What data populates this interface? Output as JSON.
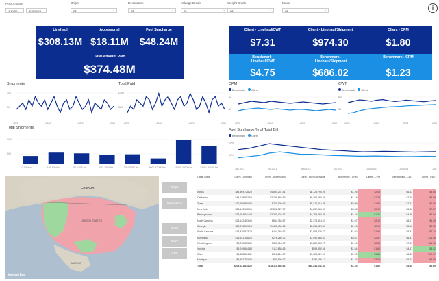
{
  "filters": {
    "period_label": "PERIOD DATE",
    "date_from": "1/1/2021",
    "date_to": "5/31/2024",
    "origin_label": "Origin",
    "destination_label": "Destination",
    "mileage_label": "Mileage Break",
    "weight_label": "Weight Break",
    "mode_label": "Mode",
    "all": "All"
  },
  "kpis": {
    "linehaul_label": "Linehaul",
    "linehaul": "$308.13M",
    "accessorial_label": "Accessorial",
    "accessorial": "$18.11M",
    "fuel_label": "Fuel Surcharge",
    "fuel": "$48.24M",
    "total_label": "Total Amount Paid",
    "total": "$374.48M"
  },
  "client": {
    "cwt_label": "Client - Linehaul/CWT",
    "cwt": "$7.31",
    "shipment_label": "Client - Linehaul/Shipment",
    "shipment": "$974.30",
    "cpm_label": "Client - CPM",
    "cpm": "$1.80"
  },
  "benchmark": {
    "cwt_label": "Benchmark - Linehaul/CWT",
    "cwt": "$4.75",
    "shipment_label": "Benchmark - Linehaul/Shipment",
    "shipment": "$686.02",
    "cpm_label": "Benchmark - CPM",
    "cpm": "$1.23"
  },
  "charts": {
    "shipments_title": "Shipments",
    "total_paid_title": "Total Paid",
    "cpm_title": "CPM",
    "cwt_title": "CWT",
    "total_shipments_title": "Total Shipments",
    "fuel_title": "Fuel Surcharge % of Total Bill",
    "legend_benchmark": "Benchmark",
    "legend_client": "Client",
    "year_ticks": [
      "2021",
      "2022",
      "2023",
      "2024"
    ],
    "date_ticks": [
      "Jan 2021",
      "Jul 2021",
      "Jan 2022",
      "Jul 2022",
      "Jan 2023",
      "Jul 2023",
      "Jan 2024"
    ],
    "shipments_y": [
      "10K",
      "5K"
    ],
    "paid_y": [
      "$10M",
      "$5M"
    ],
    "cpm_y": [
      "$2",
      "$1"
    ],
    "cwt_y": [
      "$10",
      "$5"
    ],
    "tot_ship_y": [
      "100K",
      "50K"
    ],
    "fuel_y": [
      "20%",
      "10%"
    ]
  },
  "chart_data": [
    {
      "type": "bar",
      "title": "Total Shipments",
      "categories": [
        "0-100 lbs",
        "101-500 lbs",
        "501-1000 lbs",
        "1001-2000 lbs",
        "2001-5000 lbs",
        "5001-10000 lbs",
        "10001-20000 lbs",
        "20001-50000 lbs"
      ],
      "values": [
        34,
        48,
        45,
        40,
        41,
        24,
        100,
        75
      ],
      "ylim": [
        0,
        120
      ]
    },
    {
      "type": "line",
      "title": "Shipments",
      "x": [
        "2021",
        "2022",
        "2023",
        "2024"
      ],
      "series": [
        {
          "values": [
            8,
            9,
            10,
            8,
            11,
            9,
            12,
            10,
            9,
            11,
            8,
            10,
            12,
            9,
            7,
            10,
            11,
            8,
            9,
            12,
            10,
            8,
            9,
            11,
            7,
            10,
            9,
            8,
            11,
            10,
            8,
            9
          ]
        }
      ]
    },
    {
      "type": "line",
      "title": "Total Paid",
      "x": [
        "2021",
        "2022",
        "2023",
        "2024"
      ],
      "series": [
        {
          "values": [
            7,
            9,
            8,
            11,
            10,
            9,
            12,
            11,
            8,
            10,
            13,
            9,
            11,
            12,
            10,
            8,
            11,
            12,
            9,
            10,
            13,
            11,
            8,
            9,
            12,
            10,
            7,
            11,
            12,
            9,
            10,
            8
          ]
        }
      ]
    },
    {
      "type": "line",
      "title": "CPM",
      "x": [
        "2021",
        "2022",
        "2023",
        "2024"
      ],
      "series": [
        {
          "name": "Benchmark",
          "values": [
            1.6,
            1.7,
            1.8,
            1.75,
            1.7,
            1.8,
            1.75,
            1.7,
            1.65,
            1.7,
            1.75,
            1.7,
            1.65,
            1.6,
            1.65,
            1.7
          ]
        },
        {
          "name": "Client",
          "values": [
            1.1,
            1.2,
            1.25,
            1.3,
            1.25,
            1.2,
            1.25,
            1.2,
            1.15,
            1.2,
            1.2,
            1.15,
            1.1,
            1.15,
            1.2,
            1.15
          ]
        }
      ]
    },
    {
      "type": "line",
      "title": "CWT",
      "x": [
        "2021",
        "2022",
        "2023",
        "2024"
      ],
      "series": [
        {
          "name": "Benchmark",
          "values": [
            7,
            7.5,
            8,
            7.8,
            7.5,
            7.9,
            8.1,
            7.7,
            7.4,
            7.6,
            7.9,
            7.7,
            7.5,
            7.3,
            7.6,
            7.8
          ]
        },
        {
          "name": "Client",
          "values": [
            3,
            3.3,
            4,
            4.5,
            4.8,
            5,
            5.2,
            5.4,
            5.5,
            5.6,
            5.8,
            5.9,
            6,
            6.1,
            6.2,
            6.3
          ]
        }
      ]
    },
    {
      "type": "line",
      "title": "Fuel Surcharge % of Total Bill",
      "x": [
        "Jan 2021",
        "Jan 2024"
      ],
      "series": [
        {
          "name": "Benchmark",
          "values": [
            18,
            19,
            21,
            23,
            22,
            21,
            20,
            19,
            18,
            17.5,
            17,
            16.5,
            16,
            16.2,
            16.5,
            16.3,
            16,
            15.8,
            16,
            16.2
          ]
        },
        {
          "name": "Client",
          "values": [
            11,
            12,
            13,
            15,
            16,
            15,
            14,
            14,
            13.5,
            13,
            12.8,
            12.5,
            12.3,
            12.5,
            12.4,
            12.2,
            12,
            12.1,
            12.3,
            12.2
          ]
        }
      ]
    }
  ],
  "map": {
    "canada": "CANADA",
    "us": "UNITED STATES",
    "mexico": "MEXICO"
  },
  "slicers": [
    "Origin",
    "Destination",
    "CPM",
    "CWT",
    "CPS"
  ],
  "table": {
    "headers": [
      "Origin State",
      "Client - Linehaul",
      "Client - Accessorial",
      "Client - Fuel Surcharge",
      "Benchmark - CPM",
      "Client - CPM",
      "Benchmark - CWT",
      "Client - CWT"
    ],
    "rows": [
      [
        "Illinois",
        "$84,369,728.23",
        "$4,534,247.41",
        "$8,728,796.26",
        "$1.25",
        "$2.05",
        "$6.63",
        "$8.64"
      ],
      [
        "California",
        "$44,129,552.09",
        "$2,799,668.53",
        "$6,364,080.49",
        "$1.15",
        "$1.79",
        "$7.79",
        "$9.96"
      ],
      [
        "Texas",
        "$30,686,850.00",
        "$760,009.96",
        "$5,212,616.48",
        "$0.99",
        "$1.83",
        "$7.51",
        "$0.50"
      ],
      [
        "New York",
        "$28,443,965.96",
        "$2,808,327.37",
        "$4,252,965.59",
        "$0.98",
        "$2.42",
        "$6.46",
        "$7.07"
      ],
      [
        "Pennsylvania",
        "$23,654,841.48",
        "$2,221,434.97",
        "$4,759,460.38",
        "$1.44",
        "$1.26",
        "$4.96",
        "$6.64"
      ],
      [
        "North Carolina",
        "$23,142,453.45",
        "$834,754.67",
        "$3,373,814.67",
        "$1.07",
        "$2.10",
        "$8.17",
        "$5.29"
      ],
      [
        "Georgia",
        "$22,876,539.13",
        "$1,450,456.15",
        "$3,631,929.84",
        "$1.13",
        "$2.16",
        "$5.16",
        "$5.12"
      ],
      [
        "South Carolina",
        "$13,830,823.78",
        "$464,368.62",
        "$3,053,234.73",
        "$1.02",
        "$1.96",
        "$5.37",
        "$6.74"
      ],
      [
        "Minnesota",
        "$13,641,108.20",
        "$276,289.72",
        "$1,590,365.63",
        "$0.87",
        "$2.47",
        "$6.81",
        "$16.48"
      ],
      [
        "West Virginia",
        "$8,212,853.50",
        "$337,718.72",
        "$1,282,550.73",
        "$1.10",
        "$2.53",
        "$7.49",
        "$11.76"
      ],
      [
        "Virginia",
        "$5,249,684.84",
        "$117,658.66",
        "$959,352.66",
        "$1.54",
        "$1.64",
        "$4.67",
        "$3.52"
      ],
      [
        "Ohio",
        "$4,658,864.81",
        "$312,216.07",
        "$1,028,621.99",
        "$1.26",
        "$0.86",
        "$6.82",
        "$12.47"
      ],
      [
        "Michigan",
        "$4,482,753.09",
        "$91,606.02",
        "$792,185.12",
        "$1.43",
        "$2.08",
        "$5.52",
        "$9.08"
      ]
    ],
    "total": [
      "Total",
      "$308,131,834.20",
      "$18,110,583.62",
      "$48,241,641.40",
      "$1.23",
      "$1.80",
      "$5.85",
      "$8.69"
    ],
    "highlights": {
      "red": [
        [
          0,
          5
        ],
        [
          0,
          7
        ],
        [
          1,
          5
        ],
        [
          1,
          7
        ],
        [
          2,
          5
        ],
        [
          2,
          7
        ],
        [
          3,
          5
        ],
        [
          3,
          7
        ],
        [
          4,
          7
        ],
        [
          5,
          5
        ],
        [
          5,
          7
        ],
        [
          6,
          5
        ],
        [
          6,
          7
        ],
        [
          7,
          5
        ],
        [
          7,
          7
        ],
        [
          8,
          5
        ],
        [
          8,
          7
        ],
        [
          9,
          5
        ],
        [
          9,
          7
        ],
        [
          10,
          5
        ],
        [
          11,
          7
        ],
        [
          12,
          5
        ],
        [
          12,
          7
        ]
      ],
      "green": [
        [
          4,
          5
        ],
        [
          10,
          7
        ],
        [
          11,
          5
        ]
      ]
    }
  }
}
